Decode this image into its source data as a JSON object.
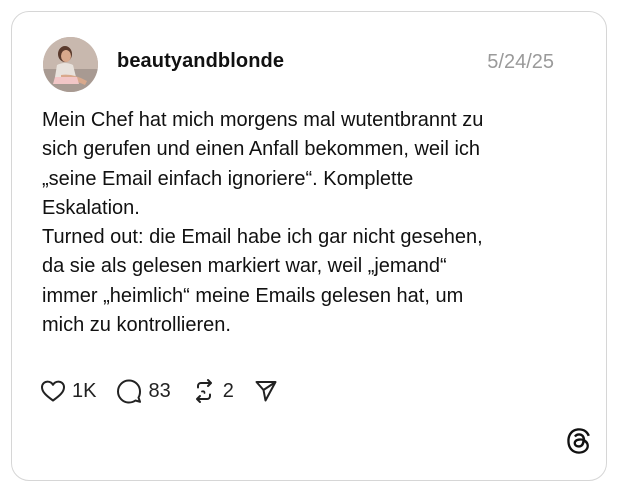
{
  "post": {
    "username": "beautyandblonde",
    "date": "5/24/25",
    "text_lines": [
      "Mein Chef hat mich morgens mal wutentbrannt zu",
      "sich gerufen und einen Anfall bekommen, weil ich",
      "„seine Email einfach ignoriere“. Komplette",
      "Eskalation.",
      "Turned out: die Email habe ich gar nicht gesehen,",
      "da sie als gelesen markiert war, weil „jemand“",
      "immer „heimlich“ meine Emails gelesen hat, um",
      "mich zu kontrollieren."
    ]
  },
  "actions": {
    "likes": "1K",
    "replies": "83",
    "reposts": "2"
  },
  "icons": {
    "like": "heart-icon",
    "reply": "comment-bubble-icon",
    "repost": "repost-icon",
    "share": "send-icon",
    "brand": "threads-logo-icon"
  }
}
